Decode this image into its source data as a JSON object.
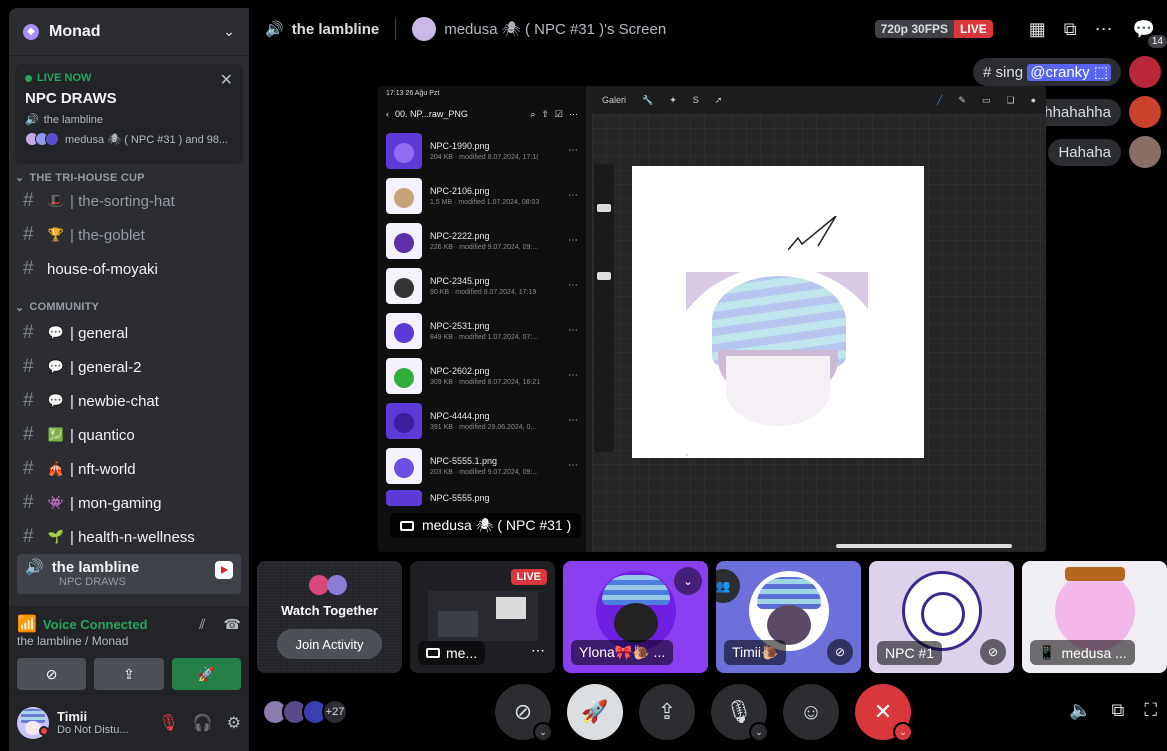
{
  "server": {
    "name": "Monad"
  },
  "live_card": {
    "status": "LIVE NOW",
    "title": "NPC DRAWS",
    "channel": "the lambline",
    "members": "medusa 🕷 ( NPC #31 ) and 98..."
  },
  "categories": [
    {
      "name": "THE TRI-HOUSE CUP"
    },
    {
      "name": "COMMUNITY"
    }
  ],
  "channels_tri": [
    {
      "emoji": "🎩",
      "label": "| the-sorting-hat"
    },
    {
      "emoji": "🏆",
      "label": "| the-goblet"
    },
    {
      "emoji": "",
      "label": "house-of-moyaki"
    }
  ],
  "channels_community": [
    {
      "emoji": "💬",
      "label": "| general"
    },
    {
      "emoji": "💬",
      "label": "| general-2"
    },
    {
      "emoji": "💬",
      "label": "| newbie-chat"
    },
    {
      "emoji": "💹",
      "label": "| quantico"
    },
    {
      "emoji": "🎪",
      "label": "| nft-world"
    },
    {
      "emoji": "👾",
      "label": "| mon-gaming"
    },
    {
      "emoji": "🌱",
      "label": "| health-n-wellness"
    }
  ],
  "voice_channel": {
    "name": "the lambline",
    "sub": "NPC DRAWS"
  },
  "voice_panel": {
    "status": "Voice Connected",
    "location": "the lambline / Monad"
  },
  "user": {
    "name": "Timii",
    "status": "Do Not Distu..."
  },
  "topbar": {
    "channel": "the lambline",
    "screen_title": "medusa 🕷 ( NPC #31 )'s Screen",
    "quality": "720p 30FPS",
    "live": "LIVE",
    "people_count": "14"
  },
  "chat_bubbles": [
    {
      "prefix": "# sing ",
      "mention": "@cranky ⬚"
    },
    {
      "text": "ahhahahha"
    },
    {
      "text": "Hahaha"
    }
  ],
  "stream": {
    "status_time": "17:13  26 Ağu Pzt",
    "folder": "00. NP...raw_PNG",
    "canvas_menu": "Galeri",
    "files": [
      {
        "name": "NPC-1990.png",
        "meta": "204 KB · modified 8.07.2024, 17:1("
      },
      {
        "name": "NPC-2106.png",
        "meta": "1,5 MB · modified 1.07.2024, 08:03"
      },
      {
        "name": "NPC-2222.png",
        "meta": "226 KB · modified 9.07.2024, 09:..."
      },
      {
        "name": "NPC-2345.png",
        "meta": "90 KB · modified 8.07.2024, 17:19"
      },
      {
        "name": "NPC-2531.png",
        "meta": "849 KB · modified 1.07.2024, 07:..."
      },
      {
        "name": "NPC-2602.png",
        "meta": "309 KB · modified 8.07.2024, 16:21"
      },
      {
        "name": "NPC-4444.png",
        "meta": "391 KB · modified 29.06.2024, 0..."
      },
      {
        "name": "NPC-5555.1.png",
        "meta": "203 KB · modified 9.07.2024, 09:..."
      },
      {
        "name": "NPC-5555.png",
        "meta": ""
      }
    ],
    "label": "medusa 🕷 ( NPC #31 )"
  },
  "tiles": {
    "watch_title": "Watch Together",
    "join_label": "Join Activity",
    "stream_label": "me...",
    "stream_live": "LIVE",
    "ylona": "Ylona🎀🐌 ...",
    "timii": "Timii🐌",
    "npc1": "NPC #1",
    "medusa": "medusa ..."
  },
  "viewers": {
    "more": "+27"
  }
}
